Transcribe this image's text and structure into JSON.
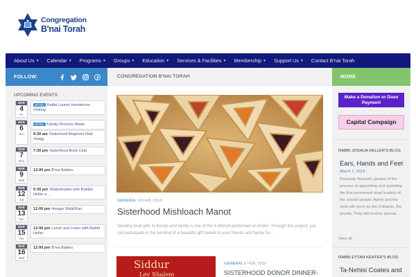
{
  "logo": {
    "line1": "Congregation",
    "line2": "B'nai Torah"
  },
  "nav": [
    {
      "label": "About Us",
      "dropdown": true
    },
    {
      "label": "Calendar",
      "dropdown": true
    },
    {
      "label": "Programs",
      "dropdown": true
    },
    {
      "label": "Groups",
      "dropdown": true
    },
    {
      "label": "Education",
      "dropdown": true
    },
    {
      "label": "Services & Facilities",
      "dropdown": true
    },
    {
      "label": "Membership",
      "dropdown": true
    },
    {
      "label": "Support Us",
      "dropdown": true
    },
    {
      "label": "Contact B'nai Torah",
      "dropdown": false
    }
  ],
  "left": {
    "follow_label": "FOLLOW:",
    "upcoming_label": "UPCOMING EVENTS",
    "events": [
      {
        "mon": "MAR",
        "day": "4",
        "dow": "Fri",
        "items": [
          {
            "allday": "all-day",
            "time": "",
            "title": "Rabbi Lauren Henderson Visiting"
          }
        ]
      },
      {
        "mon": "MAR",
        "day": "6",
        "dow": "Sun",
        "items": [
          {
            "allday": "all-day",
            "time": "",
            "title": "Family Promise Week"
          },
          {
            "allday": "",
            "time": "9:30 am",
            "title": "Sisterhood Beginner Mah Jongg"
          }
        ]
      },
      {
        "mon": "MAR",
        "day": "7",
        "dow": "Mon",
        "items": [
          {
            "allday": "",
            "time": "7:30 pm",
            "title": "Sisterhood Book Club"
          }
        ]
      },
      {
        "mon": "MAR",
        "day": "9",
        "dow": "Wed",
        "items": [
          {
            "allday": "",
            "time": "12:00 pm",
            "title": "B'nai Babies"
          }
        ]
      },
      {
        "mon": "MAR",
        "day": "12",
        "dow": "Sat",
        "items": [
          {
            "allday": "",
            "time": "5:30 pm",
            "title": "Shaleshudes with Rabbis Heller a..."
          }
        ]
      },
      {
        "mon": "MAR",
        "day": "13",
        "dow": "Sun",
        "items": [
          {
            "allday": "",
            "time": "12:00 pm",
            "title": "Hunger Walk/Run"
          }
        ]
      },
      {
        "mon": "MAR",
        "day": "15",
        "dow": "Tue",
        "items": [
          {
            "allday": "",
            "time": "12:00 pm",
            "title": "Lunch and Learn with Rabbi Heller"
          }
        ]
      },
      {
        "mon": "MAR",
        "day": "16",
        "dow": "Wed",
        "items": [
          {
            "allday": "",
            "time": "12:00 pm",
            "title": "B'nai Babies"
          }
        ]
      }
    ]
  },
  "center": {
    "crumb": "CONGREGATION B'NAI TORAH",
    "post1": {
      "category": "GENERAL",
      "date": "18 FEB, 2016",
      "title": "Sisterhood Mishloach Manot",
      "excerpt": "Sending food gifts to friends and family is one of the 4 Mitzvot performed on Purim. Through this project, you can participate in the sending of a beautiful gift basket to your friends and family for..."
    },
    "post2": {
      "image_title": "Siddur",
      "image_subtitle": "Lev Shalem",
      "category": "GENERAL",
      "date": "8 FEB, 2016",
      "title": "SISTERHOOD DONOR DINNER-"
    }
  },
  "right": {
    "more_label": "MORE",
    "donate": "Make a Donation or Dues Payment",
    "capital": "Capital Campaign",
    "blog1": {
      "heading": "RABBI JOSHUA HELLER'S BLOG",
      "title": "Ears, Hands and Feet",
      "date": "March 1, 2016",
      "text": "Parashat Tetzaveh speaks of the process of appointing and anointing the first permanent ritual leaders of the Jewish people. Aaron and his sons will serve as the Cohanim, the priests. They will receive special..."
    },
    "view_all": "View all",
    "blog2": {
      "heading": "RABBI EYTAN KENTER'S BLOG",
      "title": "Ta-Nehisi Coates and"
    }
  },
  "colors": {
    "nav_bg": "#11197c",
    "follow_bar": "#3b87c8",
    "more_bar": "#82c46c",
    "donate_btn": "#5b22c9",
    "capital_btn": "#f7cfea",
    "logo_blue": "#1d3f8a"
  },
  "icons": {
    "social": [
      "facebook-icon",
      "twitter-icon",
      "instagram-icon",
      "pinterest-icon"
    ]
  }
}
